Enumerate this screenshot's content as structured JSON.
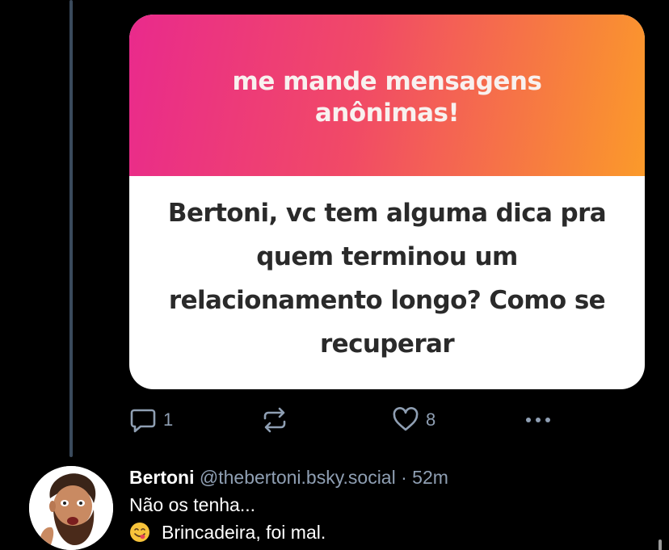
{
  "embed": {
    "title": "me mande mensagens anônimas!",
    "question": "Bertoni, vc tem alguma dica pra quem terminou um relacionamento longo? Como se recuperar",
    "colors": {
      "gradient_start": "#e92a8c",
      "gradient_end": "#fb9a2a",
      "title_text": "#f8f1ef",
      "body_text": "#2a2a2a"
    }
  },
  "actions": {
    "reply": {
      "icon": "speech-bubble-icon",
      "count": "1"
    },
    "repost": {
      "icon": "repost-arrows-icon"
    },
    "like": {
      "icon": "heart-icon",
      "count": "8"
    },
    "more": {
      "icon": "ellipsis-icon"
    }
  },
  "reply_post": {
    "author_name": "Bertoni",
    "author_handle": "@thebertoni.bsky.social",
    "separator": "·",
    "timestamp": "52m",
    "line1": "Não os tenha...",
    "line2": "Brincadeira, foi mal.",
    "emoji": "face-savoring-food-emoji"
  },
  "colors": {
    "background": "#000000",
    "muted_text": "#8f9fb3",
    "thread_line": "#3a4a5c"
  }
}
